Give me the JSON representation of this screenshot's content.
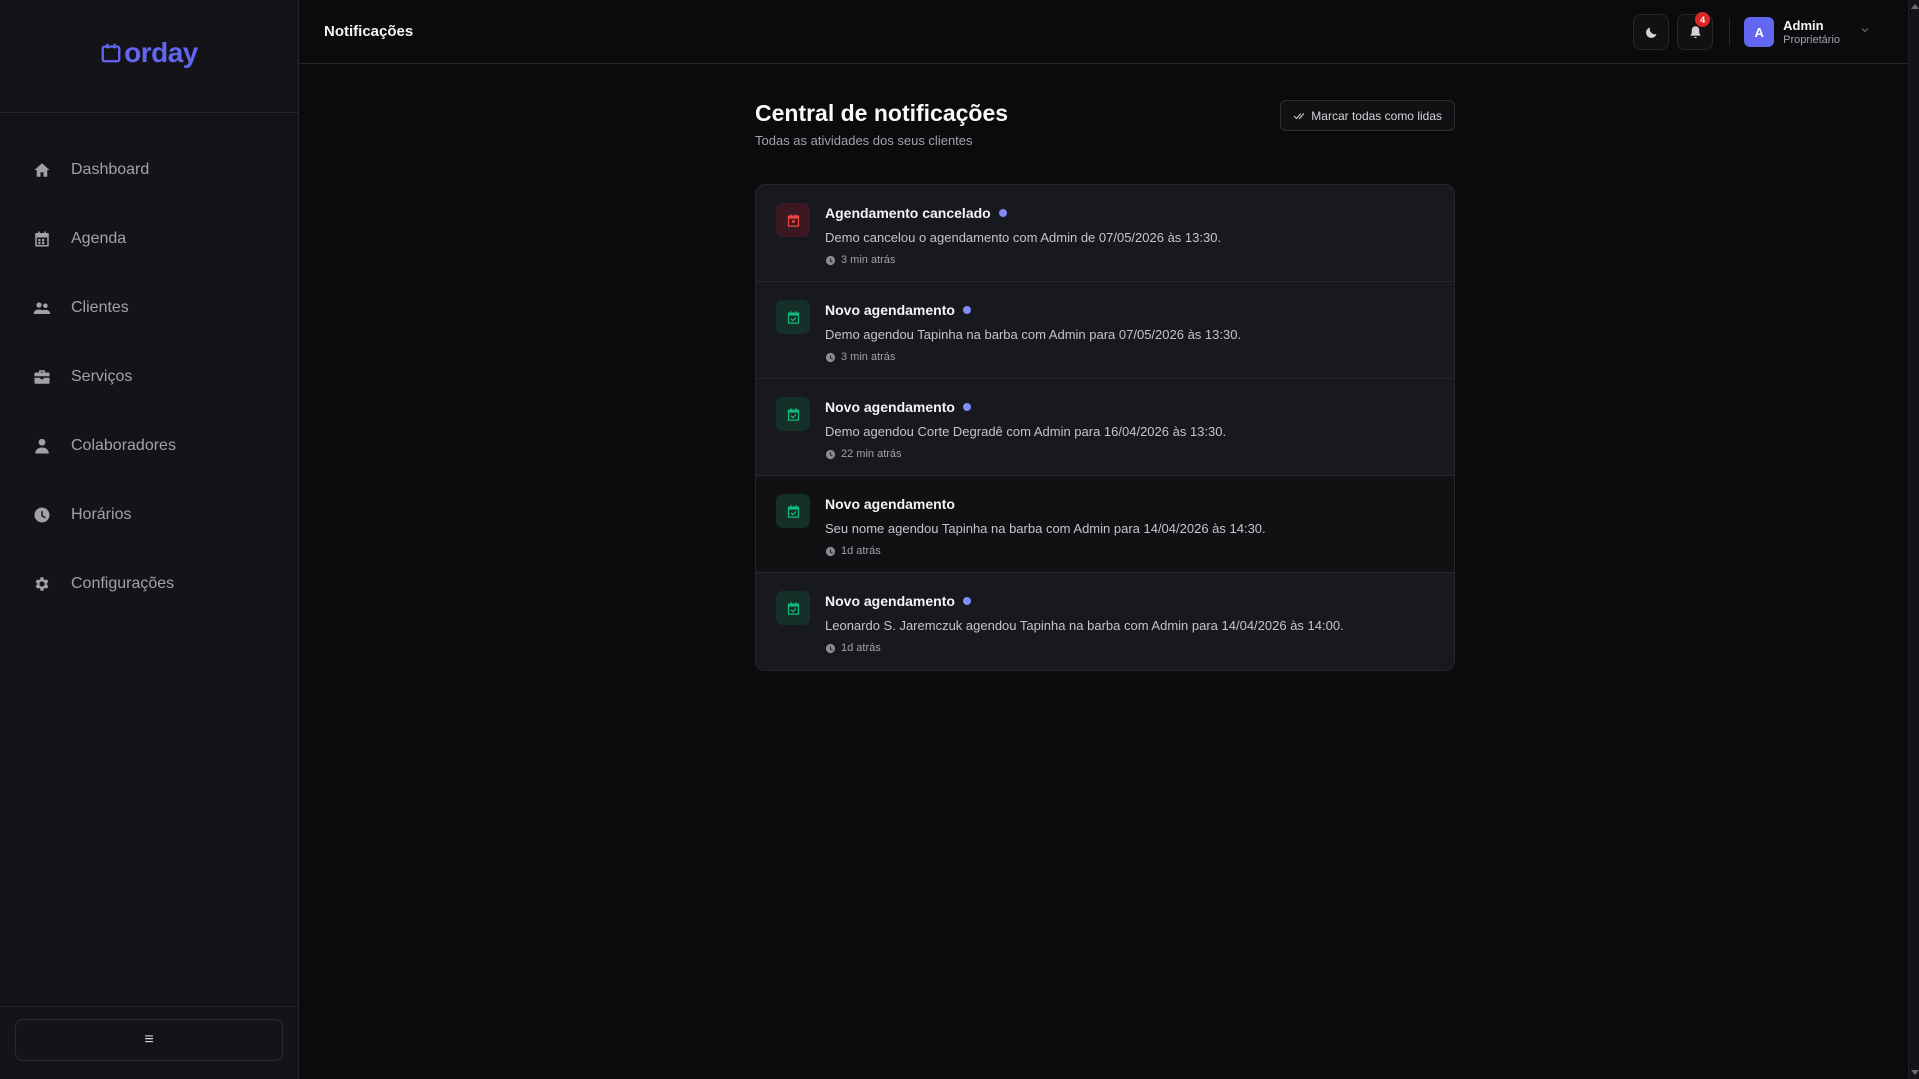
{
  "brand": {
    "name": "orday",
    "color": "#6366f1"
  },
  "sidebar": {
    "items": [
      {
        "label": "Dashboard",
        "icon": "home-icon"
      },
      {
        "label": "Agenda",
        "icon": "calendar-icon"
      },
      {
        "label": "Clientes",
        "icon": "users-icon"
      },
      {
        "label": "Serviços",
        "icon": "briefcase-icon"
      },
      {
        "label": "Colaboradores",
        "icon": "user-icon"
      },
      {
        "label": "Horários",
        "icon": "clock-icon"
      },
      {
        "label": "Configurações",
        "icon": "gear-icon"
      }
    ],
    "collapse_label": "≡"
  },
  "header": {
    "title": "Notificações",
    "notification_count": "4",
    "user": {
      "initial": "A",
      "name": "Admin",
      "role": "Proprietário"
    }
  },
  "main": {
    "title": "Central de notificações",
    "subtitle": "Todas as atividades dos seus clientes",
    "mark_all_label": "Marcar todas como lidas",
    "notifications": [
      {
        "type": "cancel",
        "title": "Agendamento cancelado",
        "unread": true,
        "message": "Demo cancelou o agendamento com Admin de 07/05/2026 às 13:30.",
        "time": "3 min atrás"
      },
      {
        "type": "new",
        "title": "Novo agendamento",
        "unread": true,
        "message": "Demo agendou Tapinha na barba com Admin para 07/05/2026 às 13:30.",
        "time": "3 min atrás"
      },
      {
        "type": "new",
        "title": "Novo agendamento",
        "unread": true,
        "message": "Demo agendou Corte Degradê com Admin para 16/04/2026 às 13:30.",
        "time": "22 min atrás"
      },
      {
        "type": "new",
        "title": "Novo agendamento",
        "unread": false,
        "message": "Seu nome agendou Tapinha na barba com Admin para 14/04/2026 às 14:30.",
        "time": "1d atrás"
      },
      {
        "type": "new",
        "title": "Novo agendamento",
        "unread": true,
        "message": "Leonardo S. Jaremczuk agendou Tapinha na barba com Admin para 14/04/2026 às 14:00.",
        "time": "1d atrás"
      }
    ]
  },
  "colors": {
    "accent": "#6366f1",
    "cancel": "#ef4444",
    "success": "#10b981",
    "unread_dot": "#818cf8"
  }
}
